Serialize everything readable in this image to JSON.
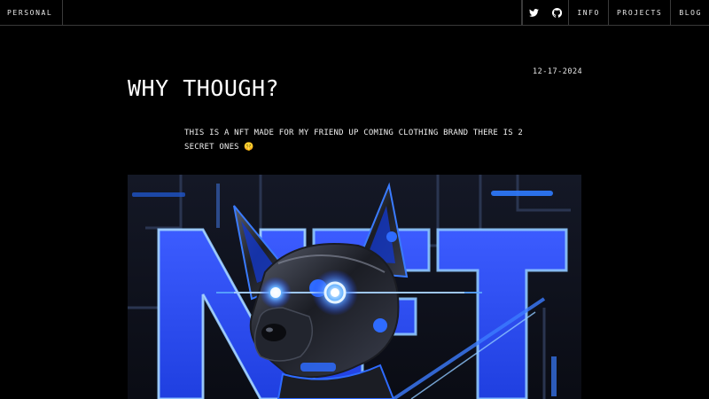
{
  "header": {
    "brand": "PERSONAL",
    "icons": [
      "twitter-icon",
      "github-icon"
    ],
    "nav": [
      "INFO",
      "PROJECTS",
      "BLOG"
    ]
  },
  "post": {
    "date": "12-17-2024",
    "title": "WHY THOUGH?",
    "body": "THIS IS A NFT MADE FOR MY FRIEND UP COMING CLOTHING BRAND THERE IS 2 SECRET ONES 🤫"
  },
  "hero": {
    "caption_letters": "NFT",
    "accent": "#2e6bff",
    "glow": "#6fb8ff"
  }
}
